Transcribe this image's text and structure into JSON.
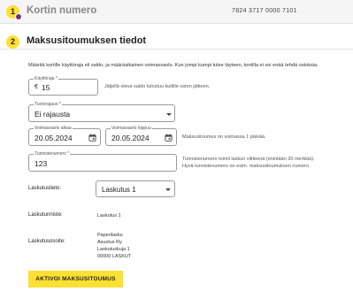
{
  "steps": [
    {
      "number": "1",
      "title": "Kortin numero",
      "card_number": "7824 3717 0000 7101"
    },
    {
      "number": "2",
      "title": "Maksusitoumuksen tiedot"
    }
  ],
  "intro": "Määritä kortille käyttöraja eli saldo, ja määräaikainen voimassaolo. Kun jompi kumpi tulee täyteen, kortilla ei voi enää tehdä ostoksia.",
  "limit": {
    "label": "Käyttöraja *",
    "currency": "€",
    "value": "15",
    "helper": "Jäljellä oleva saldo tulostuu kuitille oston jälkeen."
  },
  "product_limit": {
    "label": "Tuoterajaus *",
    "value": "Ei rajausta"
  },
  "valid_from": {
    "label": "Voimassaolo alkaa",
    "value": "20.05.2024"
  },
  "valid_to": {
    "label": "Voimassaolo loppuu",
    "value": "20.05.2024"
  },
  "validity_helper": "Maksusitoumus on voimassa 1 päivää.",
  "identifier": {
    "label": "Tunnistenumero *",
    "value": "123",
    "helper_line1": "Tunnistenumero toimii laskun viitteenä (enintään 20 merkkiä).",
    "helper_line2": "Hyvä tunnistenumero on esim. maksusitoumuksen numero."
  },
  "billing": {
    "info_label": "Laskutustieto:",
    "info_value": "Laskutus 1",
    "id_label": "Laskutunniste:",
    "id_value": "Laskutus 1",
    "address_label": "Laskutusosoite:",
    "address_lines": [
      "Paperilasku",
      "Asustus Ry",
      "Laskutuskuja 1",
      "00000 LASKUT"
    ]
  },
  "submit_label": "AKTIVOI MAKSUSITOUMUS"
}
